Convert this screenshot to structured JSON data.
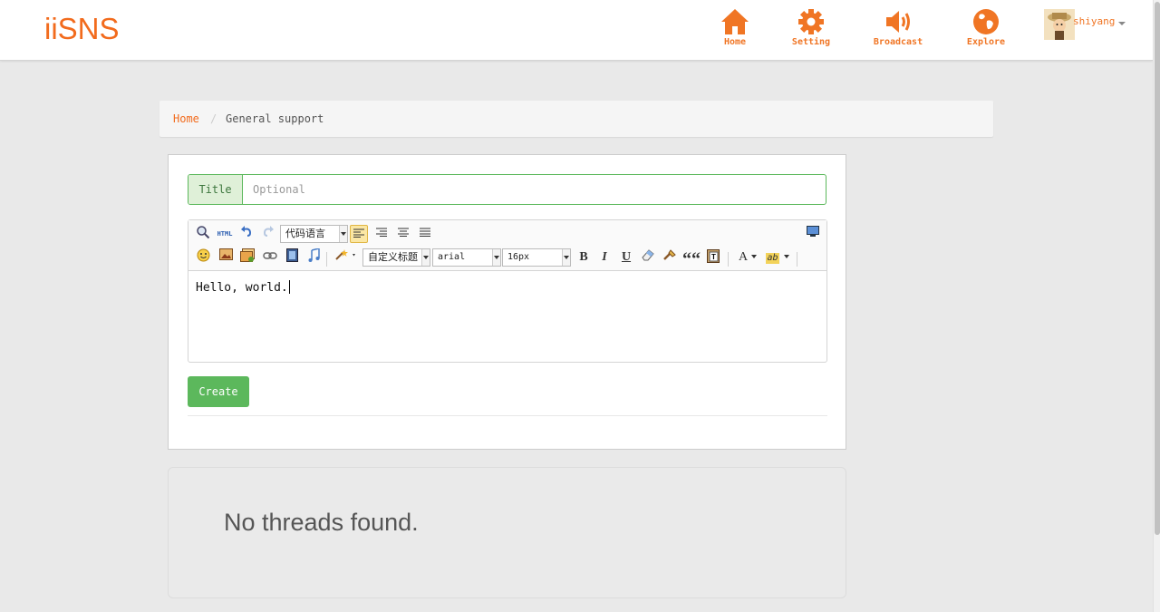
{
  "brand": "iiSNS",
  "colors": {
    "accent": "#f26b1d",
    "success": "#5cb85c",
    "background": "#e9e9e9"
  },
  "nav": {
    "items": [
      {
        "label": "Home",
        "icon": "home-icon"
      },
      {
        "label": "Setting",
        "icon": "gear-icon"
      },
      {
        "label": "Broadcast",
        "icon": "speaker-icon"
      },
      {
        "label": "Explore",
        "icon": "globe-icon"
      }
    ],
    "user": {
      "name": "shiyang",
      "avatar": "avatar-image"
    }
  },
  "breadcrumb": {
    "home": "Home",
    "separator": "/",
    "current": "General support"
  },
  "form": {
    "title_addon": "Title",
    "title_placeholder": "Optional",
    "toolbar": {
      "code_language": "代码语言",
      "custom_heading": "自定义标题",
      "font_family": "arial",
      "font_size": "16px",
      "bold": "B",
      "italic": "I",
      "underline": "U",
      "quote": "““",
      "font_color": "A",
      "html_label": "HTML",
      "highlight_label": "ab"
    },
    "editor_content": "Hello, world.",
    "submit_label": "Create"
  },
  "threads": {
    "empty_message": "No threads found."
  }
}
